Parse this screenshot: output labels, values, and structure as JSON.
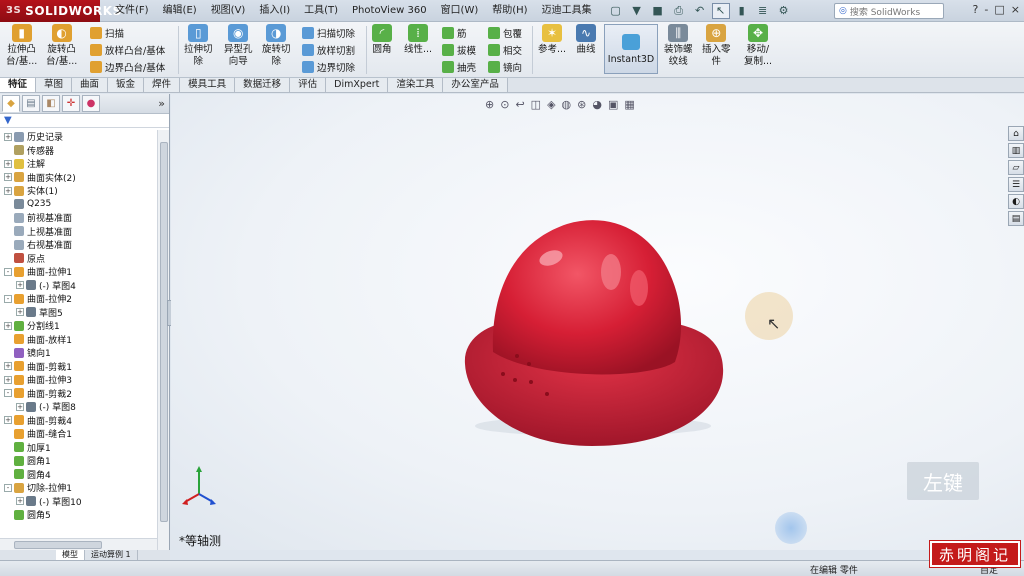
{
  "app": {
    "logo": "SOLIDWORKS",
    "logo_ds": "3S",
    "menu": [
      "文件(F)",
      "编辑(E)",
      "视图(V)",
      "插入(I)",
      "工具(T)",
      "PhotoView 360",
      "窗口(W)",
      "帮助(H)",
      "迈迪工具集"
    ],
    "search_placeholder": "搜索 SolidWorks",
    "window_buttons": [
      "?",
      "-",
      "□",
      "×"
    ]
  },
  "toolbar": {
    "extrude_boss": "拉伸凸\n台/基...",
    "revolve_boss": "旋转凸\n台/基...",
    "sweep": "扫描",
    "loft_boss": "放样凸台/基体",
    "boundary_boss": "边界凸台/基体",
    "extrude_cut": "拉伸切\n除",
    "hole_wizard": "异型孔\n向导",
    "revolve_cut": "旋转切\n除",
    "swept_cut": "扫描切除",
    "lofted_cut": "放样切割",
    "boundary_cut": "边界切除",
    "fillet": "圆角",
    "linear_pattern": "线性...",
    "rib": "筋",
    "draft": "拔模",
    "shell": "抽壳",
    "wrap": "包覆",
    "intersect": "相交",
    "mirror": "镜向",
    "reference": "参考...",
    "curves": "曲线",
    "instant3d": "Instant3D",
    "cosmetic_thread": "装饰螺\n纹线",
    "insert_part": "插入零\n件",
    "move_copy": "移动/\n复制..."
  },
  "tabs": [
    "特征",
    "草图",
    "曲面",
    "钣金",
    "焊件",
    "模具工具",
    "数据迁移",
    "评估",
    "DimXpert",
    "渲染工具",
    "办公室产品"
  ],
  "feature_tree": {
    "nodes": [
      {
        "label": "历史记录",
        "indent": 0,
        "toggle": "+",
        "color": "#8a9bb0"
      },
      {
        "label": "传感器",
        "indent": 0,
        "toggle": "",
        "color": "#b0a060"
      },
      {
        "label": "注解",
        "indent": 0,
        "toggle": "+",
        "color": "#e0c040"
      },
      {
        "label": "曲面实体(2)",
        "indent": 0,
        "toggle": "+",
        "color": "#d9a441"
      },
      {
        "label": "实体(1)",
        "indent": 0,
        "toggle": "+",
        "color": "#d9a441"
      },
      {
        "label": "Q235",
        "indent": 0,
        "toggle": "",
        "color": "#7a8a9a"
      },
      {
        "label": "前视基准面",
        "indent": 0,
        "toggle": "",
        "color": "#9aaabb"
      },
      {
        "label": "上视基准面",
        "indent": 0,
        "toggle": "",
        "color": "#9aaabb"
      },
      {
        "label": "右视基准面",
        "indent": 0,
        "toggle": "",
        "color": "#9aaabb"
      },
      {
        "label": "原点",
        "indent": 0,
        "toggle": "",
        "color": "#c05040"
      },
      {
        "label": "曲面-拉伸1",
        "indent": 0,
        "toggle": "-",
        "color": "#e8a030"
      },
      {
        "label": "(-) 草图4",
        "indent": 1,
        "toggle": "+",
        "color": "#6a7a8a"
      },
      {
        "label": "曲面-拉伸2",
        "indent": 0,
        "toggle": "-",
        "color": "#e8a030"
      },
      {
        "label": "草图5",
        "indent": 1,
        "toggle": "+",
        "color": "#6a7a8a"
      },
      {
        "label": "分割线1",
        "indent": 0,
        "toggle": "+",
        "color": "#60b040"
      },
      {
        "label": "曲面-放样1",
        "indent": 0,
        "toggle": "",
        "color": "#e8a030"
      },
      {
        "label": "镜向1",
        "indent": 0,
        "toggle": "",
        "color": "#9060c0"
      },
      {
        "label": "曲面-剪裁1",
        "indent": 0,
        "toggle": "+",
        "color": "#e8a030"
      },
      {
        "label": "曲面-拉伸3",
        "indent": 0,
        "toggle": "+",
        "color": "#e8a030"
      },
      {
        "label": "曲面-剪裁2",
        "indent": 0,
        "toggle": "-",
        "color": "#e8a030"
      },
      {
        "label": "(-) 草图8",
        "indent": 1,
        "toggle": "+",
        "color": "#6a7a8a"
      },
      {
        "label": "曲面-剪裁4",
        "indent": 0,
        "toggle": "+",
        "color": "#e8a030"
      },
      {
        "label": "曲面-缝合1",
        "indent": 0,
        "toggle": "",
        "color": "#e8a030"
      },
      {
        "label": "加厚1",
        "indent": 0,
        "toggle": "",
        "color": "#60b040"
      },
      {
        "label": "圆角1",
        "indent": 0,
        "toggle": "",
        "color": "#60b040"
      },
      {
        "label": "圆角4",
        "indent": 0,
        "toggle": "",
        "color": "#60b040"
      },
      {
        "label": "切除-拉伸1",
        "indent": 0,
        "toggle": "-",
        "color": "#d9a441"
      },
      {
        "label": "(-) 草图10",
        "indent": 1,
        "toggle": "+",
        "color": "#6a7a8a"
      },
      {
        "label": "圆角5",
        "indent": 0,
        "toggle": "",
        "color": "#60b040"
      }
    ]
  },
  "viewport": {
    "view_label": "*等轴测",
    "key_overlay": "左键",
    "model_color": "#d61f35",
    "model_highlight": "#f07a86",
    "model_shadow": "#8d0d1e"
  },
  "bottom_tabs": [
    "模型",
    "运动算例 1"
  ],
  "status": {
    "editing": "在编辑 零件",
    "custom": "自定"
  },
  "watermark": "赤明阁记"
}
